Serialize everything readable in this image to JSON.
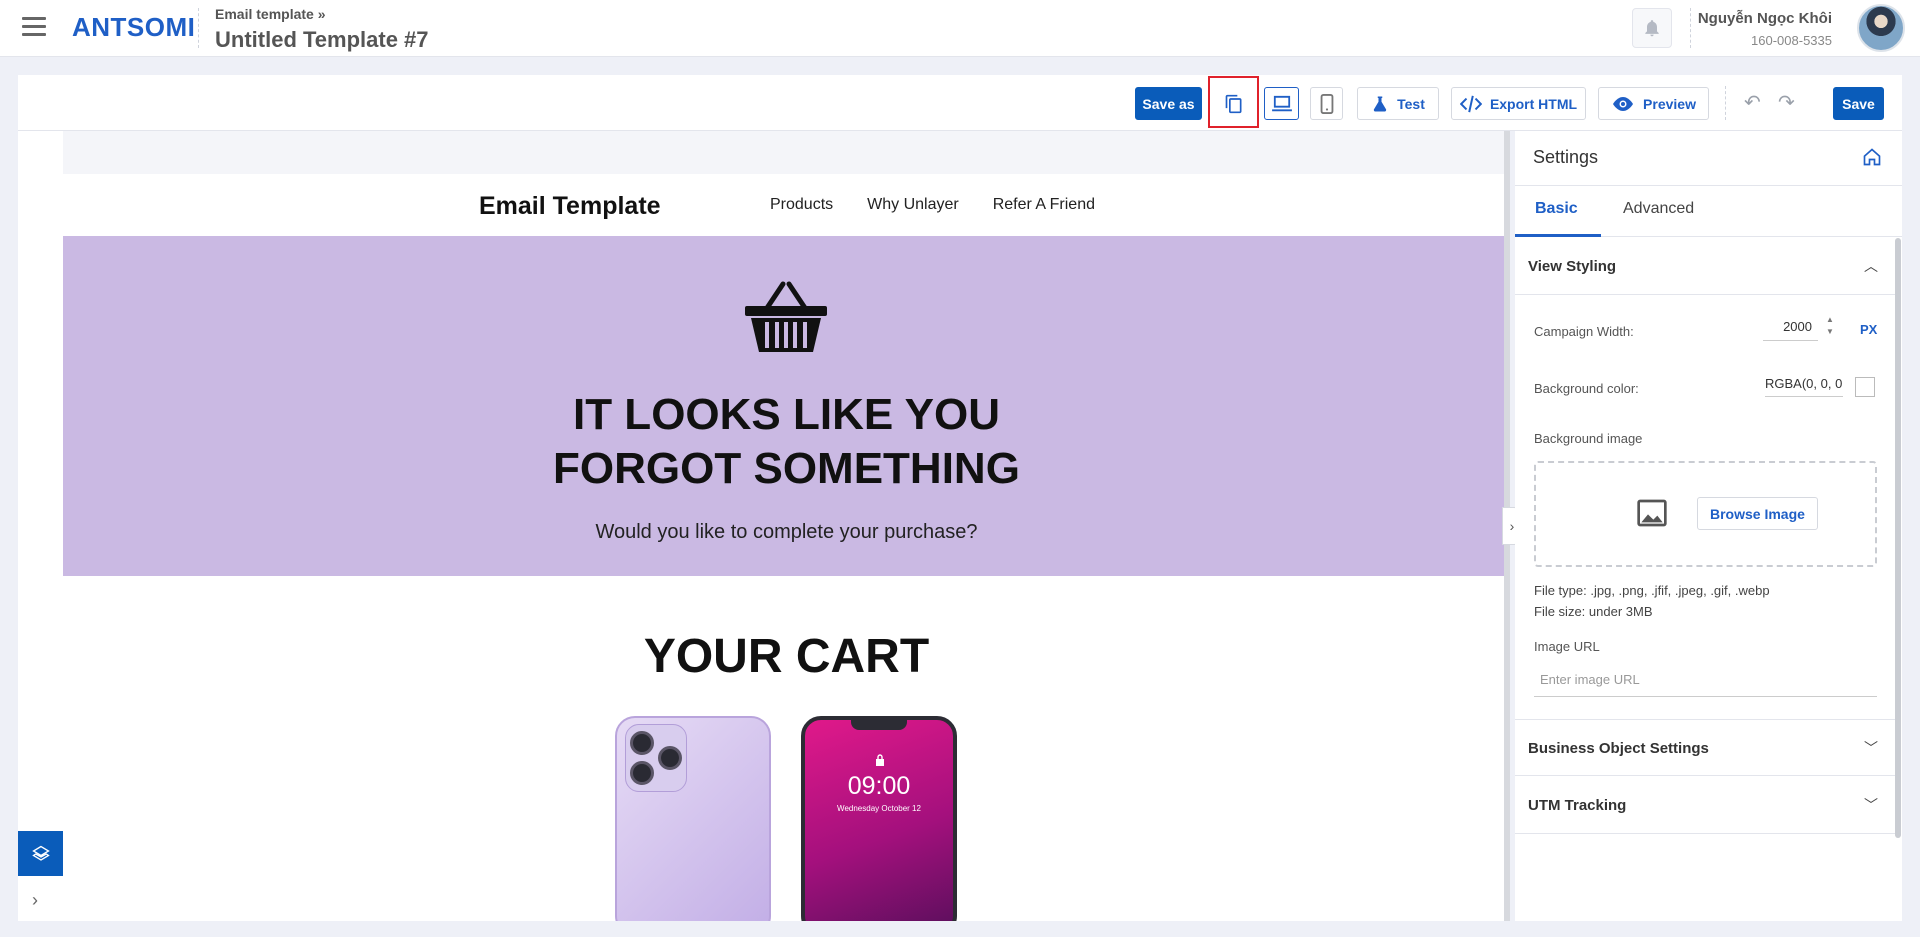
{
  "header": {
    "logo": "ANTSOMI",
    "breadcrumb": "Email template »",
    "title": "Untitled Template #7",
    "user_name": "Nguyễn Ngọc Khôi",
    "user_phone": "160-008-5335"
  },
  "toolbar": {
    "save_as": "Save as",
    "test": "Test",
    "export_html": "Export HTML",
    "preview": "Preview",
    "save": "Save"
  },
  "email": {
    "brand": "Email Template",
    "nav_links": [
      "Products",
      "Why Unlayer",
      "Refer A Friend"
    ],
    "hero_title_line1": "IT LOOKS LIKE YOU",
    "hero_title_line2": "FORGOT SOMETHING",
    "hero_subtitle": "Would you like to complete your purchase?",
    "cart_title": "YOUR CART",
    "lock_time": "09:00",
    "lock_date": "Wednesday October 12"
  },
  "settings": {
    "title": "Settings",
    "tabs": [
      "Basic",
      "Advanced"
    ],
    "view_styling": "View Styling",
    "campaign_width_label": "Campaign Width:",
    "campaign_width_value": "2000",
    "campaign_width_unit": "PX",
    "background_color_label": "Background color:",
    "background_color_value": "RGBA(0, 0, 0",
    "background_image_label": "Background image",
    "browse_image": "Browse Image",
    "file_type": "File type: .jpg, .png, .jfif, .jpeg, .gif, .webp",
    "file_size": "File size: under 3MB",
    "image_url_label": "Image URL",
    "image_url_placeholder": "Enter image URL",
    "business_object_settings": "Business Object Settings",
    "utm_tracking": "UTM Tracking"
  },
  "colors": {
    "accent": "#0a5cba",
    "hero_bg": "#cab9e3",
    "highlight": "#e0212b"
  }
}
